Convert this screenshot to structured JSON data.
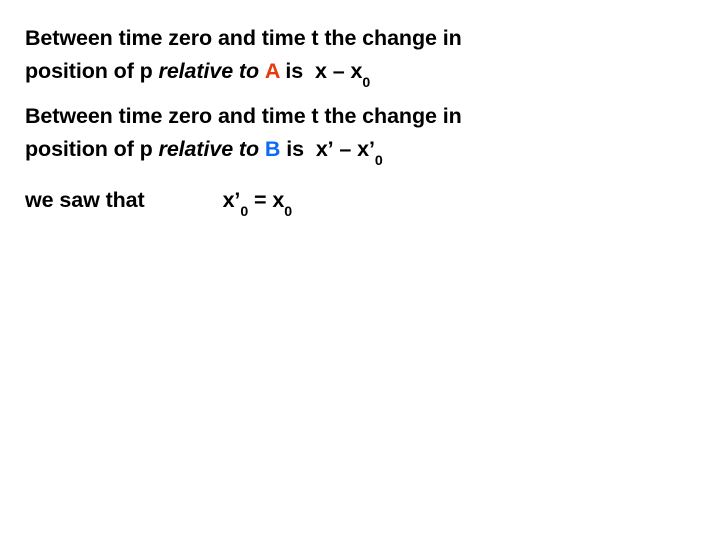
{
  "slide": {
    "background_color": "#ffffff",
    "text_color": "#000000",
    "accent_colors": {
      "frame_a": "#E8380D",
      "frame_b": "#0B6BF5"
    }
  },
  "paragraph_1": {
    "line_1": "Between time zero and time t the change in",
    "line_2_part_1": "position of p ",
    "line_2_italic": "relative to",
    "line_2_frame": "A",
    "line_2_part_2": " is ",
    "expression_var": "x",
    "expression_minus": "–",
    "expression_var2": "x",
    "expression_sub": "0"
  },
  "paragraph_2": {
    "line_1": "Between time zero and time t the change in",
    "line_2_part_1": "position of p ",
    "line_2_italic": "relative to",
    "line_2_frame": "B",
    "line_2_part_2": " is ",
    "expression_var": "x’",
    "expression_minus": "–",
    "expression_var2": "x’",
    "expression_sub": "0"
  },
  "paragraph_3": {
    "lead_text": "we saw that",
    "equation_lhs": "x’",
    "equation_lhs_sub": "0",
    "equation_operator": "=",
    "equation_rhs": "x",
    "equation_rhs_sub": "0"
  }
}
